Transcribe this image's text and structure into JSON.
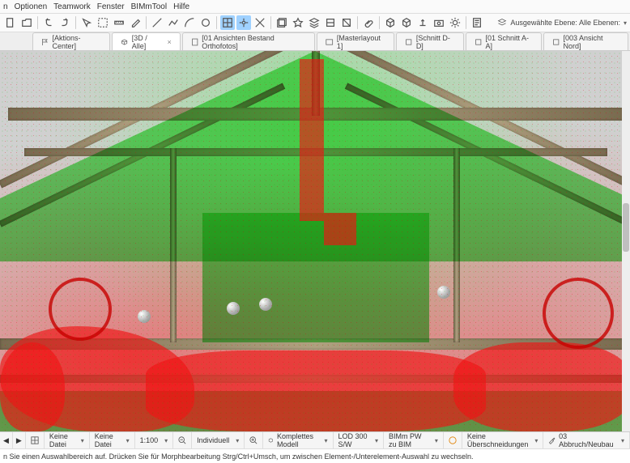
{
  "menu": {
    "items": [
      "n",
      "Optionen",
      "Teamwork",
      "Fenster",
      "BIMmTool",
      "Hilfe"
    ]
  },
  "toolbar": {
    "layer_label": "Ausgewählte Ebene: Alle Ebenen:"
  },
  "tabs": [
    {
      "label": "[Aktions-Center]",
      "active": false
    },
    {
      "label": "[3D / Alle]",
      "active": true,
      "closable": true
    },
    {
      "label": "[01 Ansichten Bestand Orthofotos]",
      "active": false
    },
    {
      "label": "[Masterlayout 1]",
      "active": false
    },
    {
      "label": "[Schnitt D-D]",
      "active": false
    },
    {
      "label": "[01 Schnitt A-A]",
      "active": false
    },
    {
      "label": "[003 Ansicht Nord]",
      "active": false
    }
  ],
  "status": {
    "coord_mode": {
      "icon": "grid"
    },
    "date1": "Keine Datei",
    "date2": "Keine Datei",
    "scale": "1:100",
    "zoom": "Individuell",
    "model": "Komplettes Modell",
    "lod": "LOD 300 S/W",
    "workset": "BIMm PW zu BIM",
    "overrides": "Keine Überschneidungen",
    "demo": "03 Abbruch/Neubau"
  },
  "hint": "n Sie einen Auswahlbereich auf. Drücken Sie für Morphbearbeitung Strg/Ctrl+Umsch, um zwischen Element-/Unterelement-Auswahl zu wechseln."
}
